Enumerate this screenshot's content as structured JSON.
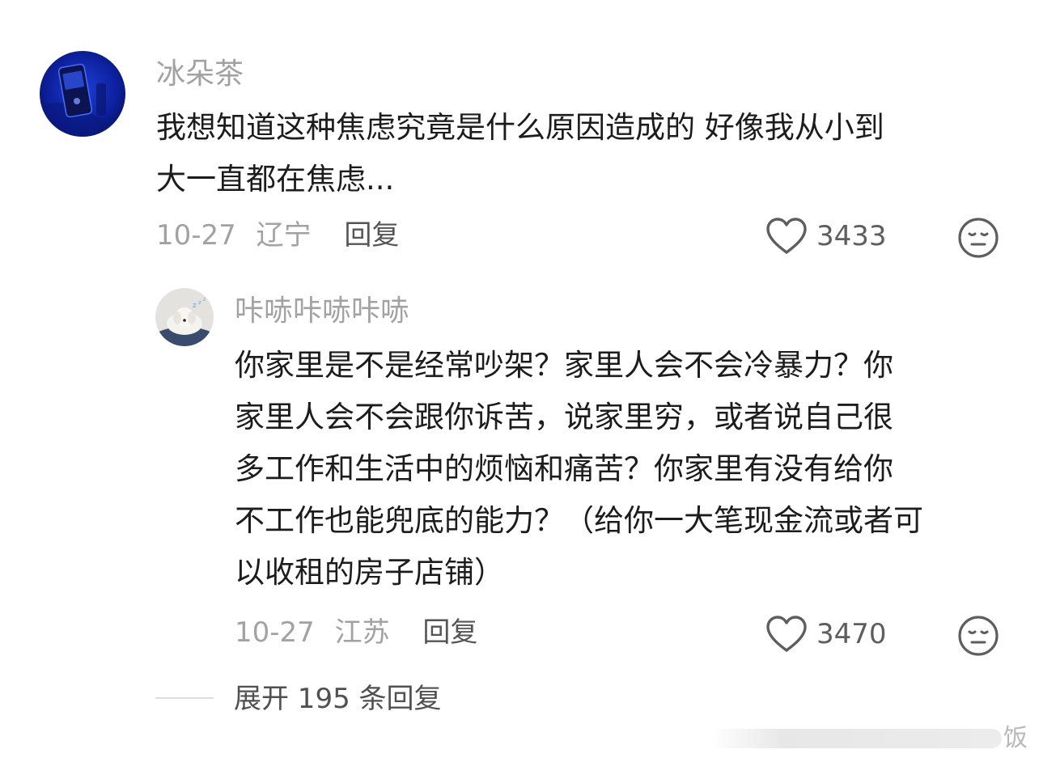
{
  "comment": {
    "username": "冰朵茶",
    "text_lines": [
      "我想知道这种焦虑究竟是什么原因造成的 好像我从小到",
      "大一直都在焦虑..."
    ],
    "date": "10-27",
    "location": "辽宁",
    "reply_label": "回复",
    "likes": "3433",
    "like_icon": "heart-outline-icon",
    "reaction_icon": "neutral-face-icon"
  },
  "reply": {
    "username": "咔哧咔哧咔哧",
    "text_lines": [
      "你家里是不是经常吵架？家里人会不会冷暴力？你",
      "家里人会不会跟你诉苦，说家里穷，或者说自己很",
      "多工作和生活中的烦恼和痛苦？你家里有没有给你",
      "不工作也能兜底的能力？（给你一大笔现金流或者可",
      "以收租的房子店铺）"
    ],
    "date": "10-27",
    "location": "江苏",
    "reply_label": "回复",
    "likes": "3470",
    "like_icon": "heart-outline-icon",
    "reaction_icon": "neutral-face-icon"
  },
  "expand_replies": "展开 195 条回复",
  "watermark_text": "饭",
  "colors": {
    "text_primary": "#1c1c1c",
    "text_secondary": "#a2a2a2",
    "icon_gray": "#5e5e5e"
  }
}
